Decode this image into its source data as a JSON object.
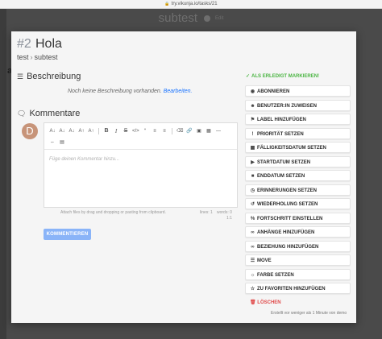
{
  "browser": {
    "url": "try.vikunja.io/tasks/21"
  },
  "background": {
    "project_title": "subtest",
    "edit_label": "Edit",
    "partial_char": "a"
  },
  "task": {
    "id": "#2",
    "title": "Hola",
    "project_parent": "test",
    "project": "subtest"
  },
  "description": {
    "heading": "Beschreibung",
    "empty_text": "Noch keine Beschreibung vorhanden.",
    "edit_link": "Bearbeiten."
  },
  "comments": {
    "heading": "Kommentare",
    "avatar_letter": "D",
    "placeholder": "Füge deinen Kommentar hinzu...",
    "attach_hint": "Attach files by drag and dropping or pasting from clipboard.",
    "lines": "lines: 1",
    "words": "words: 0",
    "cursor": "1:1",
    "submit_label": "KOMMENTIEREN"
  },
  "sidebar": {
    "done_label": "ALS ERLEDIGT MARKIEREN!",
    "actions": [
      {
        "icon": "eye-icon",
        "label": "ABONNIEREN"
      },
      {
        "icon": "users-icon",
        "label": "BENUTZER:IN ZUWEISEN"
      },
      {
        "icon": "tags-icon",
        "label": "LABEL HINZUFÜGEN"
      },
      {
        "icon": "exclamation-icon",
        "label": "PRIORITÄT SETZEN"
      },
      {
        "icon": "calendar-icon",
        "label": "FÄLLIGKEITSDATUM SETZEN"
      },
      {
        "icon": "play-icon",
        "label": "STARTDATUM SETZEN"
      },
      {
        "icon": "stop-icon",
        "label": "ENDDATUM SETZEN"
      },
      {
        "icon": "clock-icon",
        "label": "ERINNERUNGEN SETZEN"
      },
      {
        "icon": "history-icon",
        "label": "WIEDERHOLUNG SETZEN"
      },
      {
        "icon": "percent-icon",
        "label": "FORTSCHRITT EINSTELLEN"
      },
      {
        "icon": "paperclip-icon",
        "label": "ANHÄNGE HINZUFÜGEN"
      },
      {
        "icon": "link-icon",
        "label": "BEZIEHUNG HINZUFÜGEN"
      },
      {
        "icon": "list-icon",
        "label": "MOVE"
      },
      {
        "icon": "palette-icon",
        "label": "FARBE SETZEN"
      },
      {
        "icon": "star-icon",
        "label": "ZU FAVORITEN HINZUFÜGEN"
      }
    ],
    "delete_label": "LÖSCHEN",
    "created_text": "Erstellt vor weniger als 1 Minute von demo"
  },
  "colors": {
    "accent": "#1973ff",
    "done": "#4bb543",
    "danger": "#e04a4a",
    "button": "#8ab4f8"
  }
}
